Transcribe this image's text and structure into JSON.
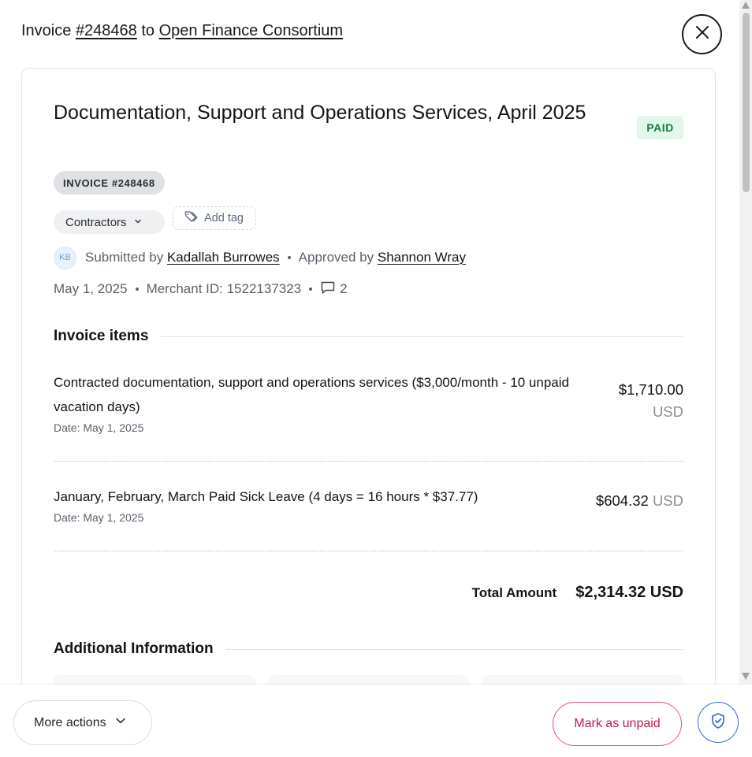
{
  "header": {
    "prefix": "Invoice",
    "invoice_link": "#248468",
    "to": "to",
    "recipient": "Open Finance Consortium"
  },
  "invoice": {
    "title": "Documentation, Support and Operations Services, April 2025",
    "status": "PAID",
    "number_pill": "INVOICE #248468",
    "category": "Contractors",
    "add_tag_label": "Add tag",
    "avatar_initials": "KB",
    "submitted_by_label": "Submitted by",
    "submitted_by": "Kadallah Burrowes",
    "approved_by_label": "Approved by",
    "approved_by": "Shannon Wray",
    "date": "May 1, 2025",
    "merchant_id": "Merchant ID: 1522137323",
    "comment_count": "2"
  },
  "items_section": {
    "heading": "Invoice items",
    "items": [
      {
        "description": "Contracted documentation, support and operations services ($3,000/month - 10 unpaid vacation days)",
        "date": "Date: May 1, 2025",
        "amount": "$1,710.00",
        "currency": "USD"
      },
      {
        "description": "January, February, March Paid Sick Leave (4 days = 16 hours * $37.77)",
        "date": "Date: May 1, 2025",
        "amount": "$604.32",
        "currency": "USD"
      }
    ],
    "total_label": "Total Amount",
    "total_value": "$2,314.32 USD"
  },
  "additional": {
    "heading": "Additional Information"
  },
  "footer": {
    "more_actions": "More actions",
    "mark_unpaid": "Mark as unpaid"
  },
  "colors": {
    "paid_bg": "#e3f6ea",
    "paid_text": "#1c7a44",
    "unpaid_accent": "#c8194a",
    "shield_accent": "#3768d6"
  }
}
